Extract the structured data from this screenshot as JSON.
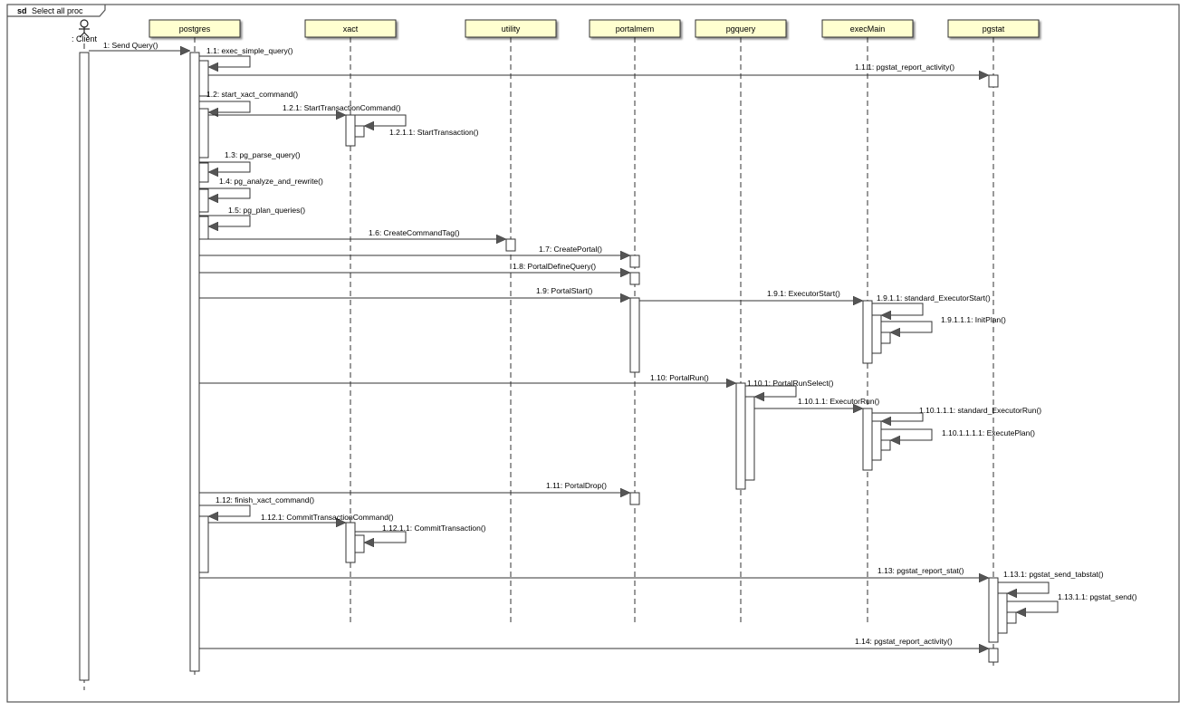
{
  "frame": {
    "keyword": "sd",
    "name": "Select all proc"
  },
  "actor": {
    "label": ": Client"
  },
  "lifelines": [
    {
      "id": "postgres",
      "label": "postgres"
    },
    {
      "id": "xact",
      "label": "xact"
    },
    {
      "id": "utility",
      "label": "utility"
    },
    {
      "id": "portalmem",
      "label": "portalmem"
    },
    {
      "id": "pgquery",
      "label": "pgquery"
    },
    {
      "id": "execMain",
      "label": "execMain"
    },
    {
      "id": "pgstat",
      "label": "pgstat"
    }
  ],
  "messages": [
    {
      "label": "1: Send Query()",
      "from": "client",
      "to": "postgres"
    },
    {
      "label": "1.1: exec_simple_query()",
      "from": "postgres",
      "to": "postgres",
      "self": true
    },
    {
      "label": "1.1.1: pgstat_report_activity()",
      "from": "postgres",
      "to": "pgstat"
    },
    {
      "label": "1.2: start_xact_command()",
      "from": "postgres",
      "to": "postgres",
      "self": true
    },
    {
      "label": "1.2.1: StartTransactionCommand()",
      "from": "postgres",
      "to": "xact"
    },
    {
      "label": "1.2.1.1: StartTransaction()",
      "from": "xact",
      "to": "xact",
      "self": true
    },
    {
      "label": "1.3: pg_parse_query()",
      "from": "postgres",
      "to": "postgres",
      "self": true
    },
    {
      "label": "1.4: pg_analyze_and_rewrite()",
      "from": "postgres",
      "to": "postgres",
      "self": true
    },
    {
      "label": "1.5: pg_plan_queries()",
      "from": "postgres",
      "to": "postgres",
      "self": true
    },
    {
      "label": "1.6: CreateCommandTag()",
      "from": "postgres",
      "to": "utility"
    },
    {
      "label": "1.7: CreatePortal()",
      "from": "postgres",
      "to": "portalmem"
    },
    {
      "label": "1.8: PortalDefineQuery()",
      "from": "postgres",
      "to": "portalmem"
    },
    {
      "label": "1.9: PortalStart()",
      "from": "postgres",
      "to": "portalmem"
    },
    {
      "label": "1.9.1: ExecutorStart()",
      "from": "portalmem",
      "to": "execMain"
    },
    {
      "label": "1.9.1.1: standard_ExecutorStart()",
      "from": "execMain",
      "to": "execMain",
      "self": true
    },
    {
      "label": "1.9.1.1.1: InitPlan()",
      "from": "execMain",
      "to": "execMain",
      "self": true
    },
    {
      "label": "1.10: PortalRun()",
      "from": "postgres",
      "to": "pgquery"
    },
    {
      "label": "1.10.1: PortalRunSelect()",
      "from": "pgquery",
      "to": "pgquery",
      "self": true
    },
    {
      "label": "1.10.1.1: ExecutorRun()",
      "from": "pgquery",
      "to": "execMain"
    },
    {
      "label": "1.10.1.1.1: standard_ExecutorRun()",
      "from": "execMain",
      "to": "execMain",
      "self": true
    },
    {
      "label": "1.10.1.1.1.1: ExecutePlan()",
      "from": "execMain",
      "to": "execMain",
      "self": true
    },
    {
      "label": "1.11: PortalDrop()",
      "from": "postgres",
      "to": "portalmem"
    },
    {
      "label": "1.12: finish_xact_command()",
      "from": "postgres",
      "to": "postgres",
      "self": true
    },
    {
      "label": "1.12.1: CommitTransactionCommand()",
      "from": "postgres",
      "to": "xact"
    },
    {
      "label": "1.12.1.1: CommitTransaction()",
      "from": "xact",
      "to": "xact",
      "self": true
    },
    {
      "label": "1.13: pgstat_report_stat()",
      "from": "postgres",
      "to": "pgstat"
    },
    {
      "label": "1.13.1: pgstat_send_tabstat()",
      "from": "pgstat",
      "to": "pgstat",
      "self": true
    },
    {
      "label": "1.13.1.1: pgstat_send()",
      "from": "pgstat",
      "to": "pgstat",
      "self": true
    },
    {
      "label": "1.14: pgstat_report_activity()",
      "from": "postgres",
      "to": "pgstat"
    }
  ],
  "colors": {
    "header_fill": "#ffffd0",
    "line": "#333333",
    "frame": "#555555"
  }
}
